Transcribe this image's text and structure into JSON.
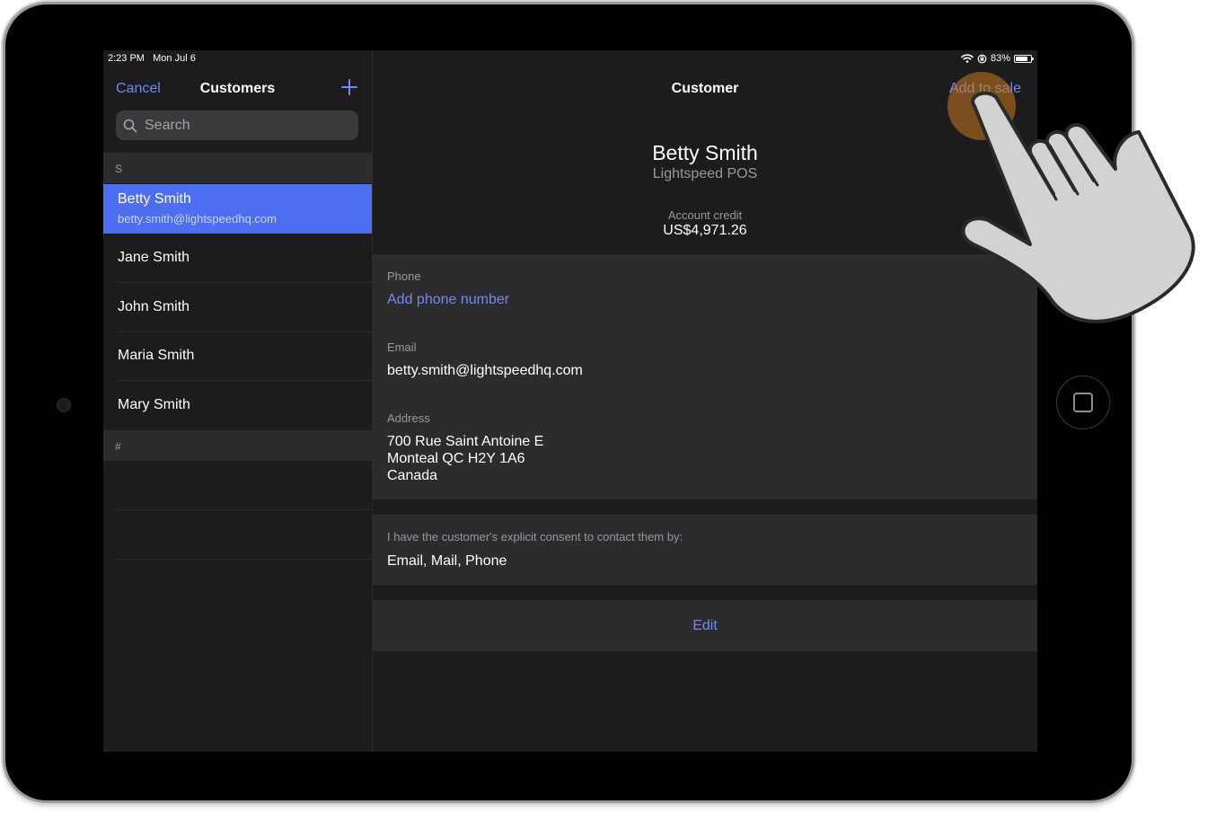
{
  "status_bar": {
    "time": "2:23 PM",
    "date": "Mon Jul 6",
    "battery": "83%",
    "battery_level": 0.83
  },
  "master": {
    "cancel_label": "Cancel",
    "title": "Customers",
    "search_placeholder": "Search",
    "sections": [
      {
        "header": "S",
        "items": [
          {
            "name": "Betty Smith",
            "email": "betty.smith@lightspeedhq.com",
            "selected": true
          },
          {
            "name": "Jane Smith"
          },
          {
            "name": "John Smith"
          },
          {
            "name": "Maria Smith"
          },
          {
            "name": "Mary Smith"
          }
        ]
      },
      {
        "header": "#",
        "items": []
      }
    ]
  },
  "detail": {
    "title": "Customer",
    "add_to_sale_label": "Add to sale",
    "name": "Betty Smith",
    "company": "Lightspeed POS",
    "credit_label": "Account credit",
    "credit_value": "US$4,971.26",
    "phone_label": "Phone",
    "phone_action": "Add phone number",
    "email_label": "Email",
    "email_value": "betty.smith@lightspeedhq.com",
    "address_label": "Address",
    "address_lines": [
      "700 Rue Saint Antoine E",
      "Monteal QC H2Y 1A6",
      "Canada"
    ],
    "consent_label": "I have the customer's explicit consent to contact them by:",
    "consent_value": "Email, Mail, Phone",
    "edit_label": "Edit"
  },
  "colors": {
    "accent": "#6e8cf5",
    "selected_row": "#4c6ef0",
    "background": "#1c1c1e",
    "card": "#2c2c2e",
    "tap_indicator": "#c87a1e"
  }
}
